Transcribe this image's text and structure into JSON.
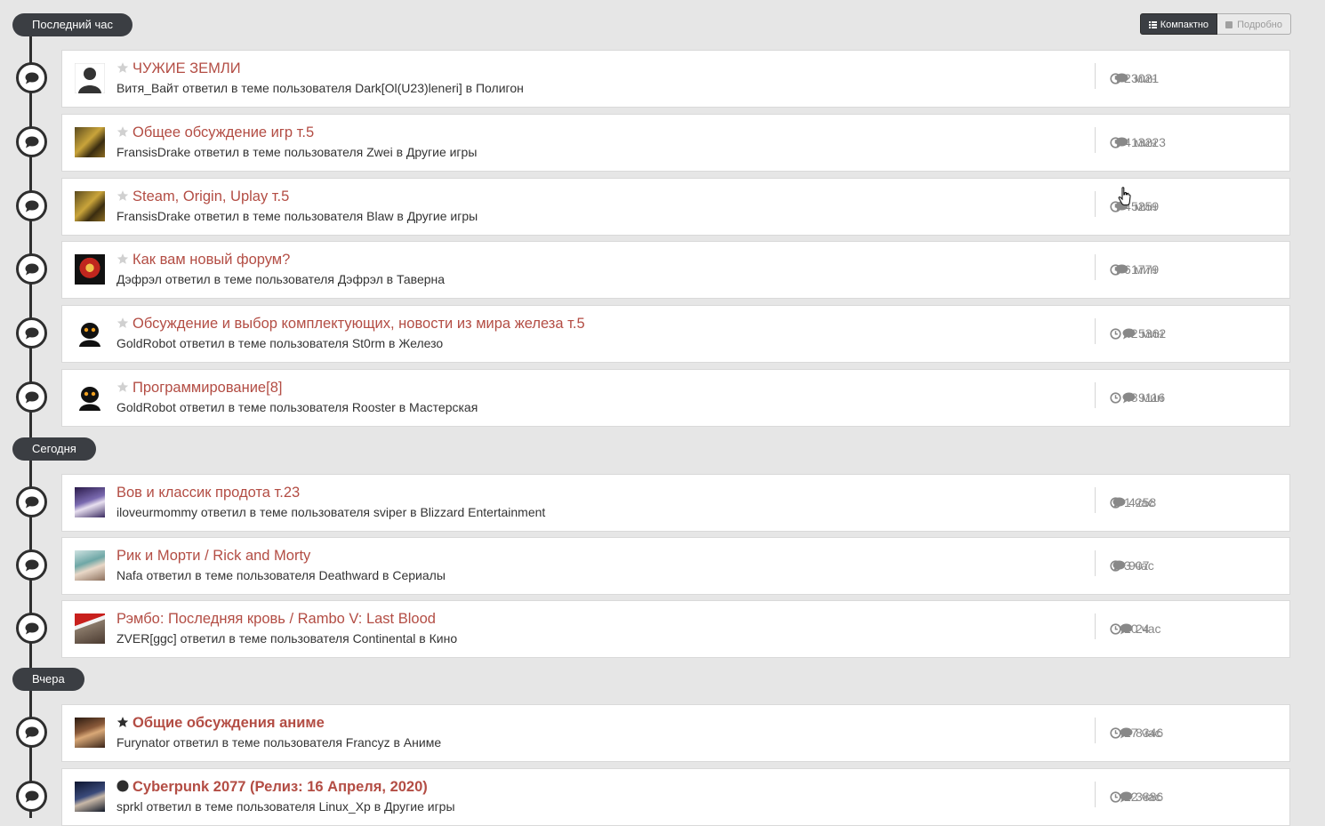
{
  "sections": {
    "last_hour": "Последний час",
    "today": "Сегодня",
    "yesterday": "Вчера"
  },
  "view_toggle": {
    "compact": "Компактно",
    "detailed": "Подробно"
  },
  "colors": {
    "title": "#b34d44",
    "pill_bg": "#3b3e43",
    "timeline": "#2e2e2e",
    "page_bg": "#e6e6e6"
  },
  "topics": [
    {
      "title": "ЧУЖИЕ ЗЕМЛИ",
      "subtitle": "Витя_Вайт ответил в теме пользователя Dark[Ol(U23)leneri] в Полигон",
      "time": "2 мин",
      "count": "3021",
      "icon": "star-outline"
    },
    {
      "title": "Общее обсуждение игр т.5",
      "subtitle": "FransisDrake ответил в теме пользователя Zwei в Другие игры",
      "time": "4 мин",
      "count": "13223",
      "icon": "star-outline"
    },
    {
      "title": "Steam, Origin, Uplay т.5",
      "subtitle": "FransisDrake ответил в теме пользователя Blaw в Другие игры",
      "time": "4 мин",
      "count": "5259",
      "icon": "star-outline"
    },
    {
      "title": "Как вам новый форум?",
      "subtitle": "Дэфрэл ответил в теме пользователя Дэфрэл в Таверна",
      "time": "6 мин",
      "count": "1779",
      "icon": "star-outline"
    },
    {
      "title": "Обсуждение и выбор комплектующих, новости из мира железа т.5",
      "subtitle": "GoldRobot ответил в теме пользователя St0rm в Железо",
      "time": "42 мин",
      "count": "5362",
      "icon": "star-outline"
    },
    {
      "title": "Программирование[8]",
      "subtitle": "GoldRobot ответил в теме пользователя Rooster в Мастерская",
      "time": "48 мин",
      "count": "9116",
      "icon": "star-outline"
    },
    {
      "title": "Вов и классик продота т.23",
      "subtitle": "iloveurmommy ответил в теме пользователя sviper в Blizzard Entertainment",
      "time": "1 час",
      "count": "4258",
      "icon": "none"
    },
    {
      "title": "Рик и Морти / Rick and Morty",
      "subtitle": "Nafa ответил в теме пользователя Deathward в Сериалы",
      "time": "3 час",
      "count": "907",
      "icon": "none"
    },
    {
      "title": "Рэмбо: Последняя кровь / Rambo V: Last Blood",
      "subtitle": "ZVER[ggc] ответил в теме пользователя Continental в Кино",
      "time": "10 час",
      "count": "24",
      "icon": "none"
    },
    {
      "title": "Общие обсуждения аниме",
      "subtitle": "Furynator ответил в теме пользователя Francyz в Аниме",
      "time": "17 час",
      "count": "8346",
      "icon": "star-filled"
    },
    {
      "title": "Cyberpunk 2077 (Релиз: 16 Апреля, 2020)",
      "subtitle": "sprkl ответил в теме пользователя Linux_Xp в Другие игры",
      "time": "22 час",
      "count": "3886",
      "icon": "circle-filled"
    }
  ]
}
